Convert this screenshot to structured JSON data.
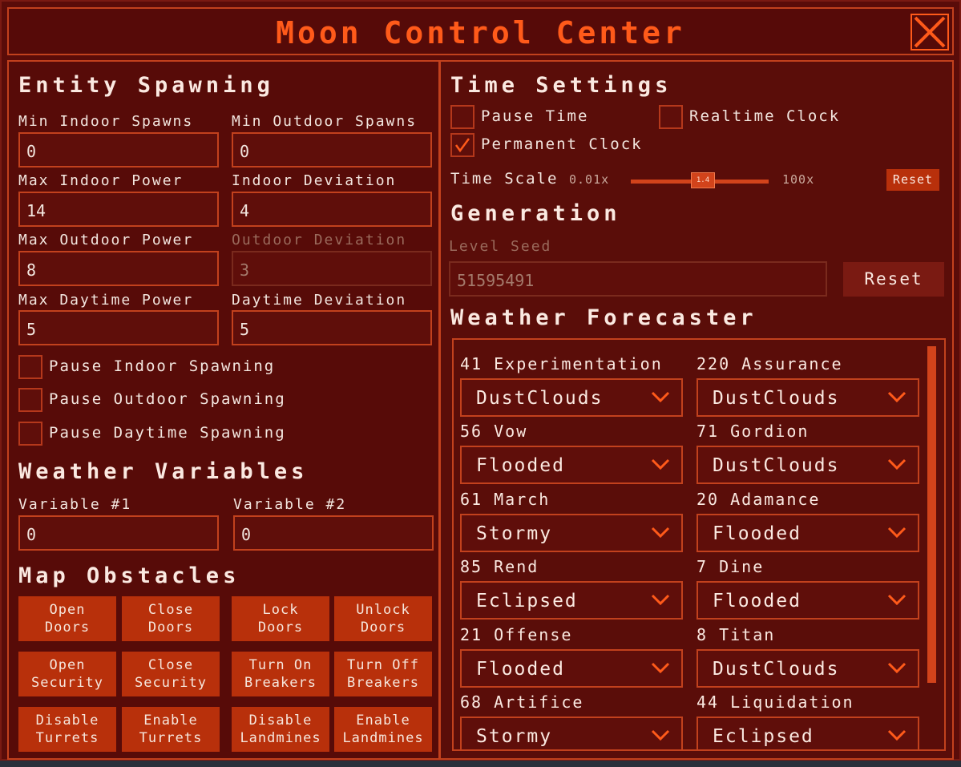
{
  "window": {
    "title": "Moon Control Center"
  },
  "entity_spawning": {
    "heading": "Entity Spawning",
    "fields": [
      {
        "label": "Min Indoor Spawns",
        "value": "0"
      },
      {
        "label": "Min Outdoor Spawns",
        "value": "0"
      },
      {
        "label": "Max Indoor Power",
        "value": "14"
      },
      {
        "label": "Indoor Deviation",
        "value": "4"
      },
      {
        "label": "Max Outdoor Power",
        "value": "8"
      },
      {
        "label": "Outdoor Deviation",
        "value": "3",
        "disabled": true
      },
      {
        "label": "Max Daytime Power",
        "value": "5"
      },
      {
        "label": "Daytime Deviation",
        "value": "5"
      }
    ],
    "checkboxes": [
      {
        "label": "Pause Indoor Spawning",
        "checked": false
      },
      {
        "label": "Pause Outdoor Spawning",
        "checked": false
      },
      {
        "label": "Pause Daytime Spawning",
        "checked": false
      }
    ]
  },
  "weather_variables": {
    "heading": "Weather Variables",
    "fields": [
      {
        "label": "Variable #1",
        "value": "0"
      },
      {
        "label": "Variable #2",
        "value": "0"
      }
    ]
  },
  "map_obstacles": {
    "heading": "Map Obstacles",
    "buttons": [
      "Open\nDoors",
      "Close\nDoors",
      "Lock\nDoors",
      "Unlock\nDoors",
      "Open\nSecurity",
      "Close\nSecurity",
      "Turn On\nBreakers",
      "Turn Off\nBreakers",
      "Disable\nTurrets",
      "Enable\nTurrets",
      "Disable\nLandmines",
      "Enable\nLandmines"
    ]
  },
  "time_settings": {
    "heading": "Time Settings",
    "pause_time": {
      "label": "Pause Time",
      "checked": false
    },
    "realtime_clock": {
      "label": "Realtime Clock",
      "checked": false
    },
    "permanent_clock": {
      "label": "Permanent Clock",
      "checked": true
    },
    "time_scale": {
      "label": "Time Scale",
      "min": "0.01x",
      "max": "100x",
      "value": "1.4",
      "reset": "Reset"
    }
  },
  "generation": {
    "heading": "Generation",
    "seed_label": "Level Seed",
    "seed_value": "51595491",
    "reset": "Reset"
  },
  "weather_forecaster": {
    "heading": "Weather Forecaster",
    "moons": [
      {
        "name": "41 Experimentation",
        "weather": "DustClouds"
      },
      {
        "name": "220 Assurance",
        "weather": "DustClouds"
      },
      {
        "name": "56 Vow",
        "weather": "Flooded"
      },
      {
        "name": "71 Gordion",
        "weather": "DustClouds"
      },
      {
        "name": "61 March",
        "weather": "Stormy"
      },
      {
        "name": "20 Adamance",
        "weather": "Flooded"
      },
      {
        "name": "85 Rend",
        "weather": "Eclipsed"
      },
      {
        "name": "7 Dine",
        "weather": "Flooded"
      },
      {
        "name": "21 Offense",
        "weather": "Flooded"
      },
      {
        "name": "8 Titan",
        "weather": "DustClouds"
      },
      {
        "name": "68 Artifice",
        "weather": "Stormy"
      },
      {
        "name": "44 Liquidation",
        "weather": "Eclipsed"
      }
    ]
  },
  "colors": {
    "accent": "#ff5a1a",
    "panel": "#570b08",
    "button": "#b8300b"
  }
}
